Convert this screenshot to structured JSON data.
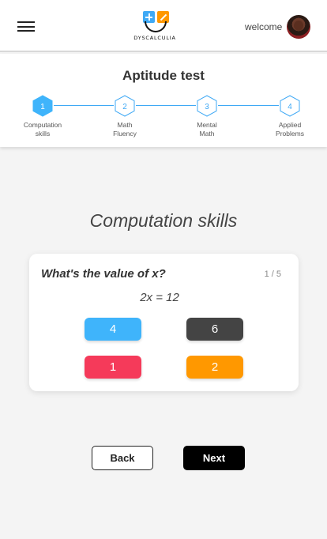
{
  "header": {
    "logo_text": "DYSCALCULIA",
    "welcome": "welcome"
  },
  "aptitude": {
    "title": "Aptitude test",
    "steps": [
      {
        "number": "1",
        "label_line1": "Computation",
        "label_line2": "skills",
        "active": true
      },
      {
        "number": "2",
        "label_line1": "Math",
        "label_line2": "Fluency",
        "active": false
      },
      {
        "number": "3",
        "label_line1": "Mental",
        "label_line2": "Math",
        "active": false
      },
      {
        "number": "4",
        "label_line1": "Applied",
        "label_line2": "Problems",
        "active": false
      }
    ]
  },
  "section_title": "Computation skills",
  "question_card": {
    "question": "What's the value of x?",
    "counter": "1 / 5",
    "equation": "2x = 12",
    "options": [
      {
        "label": "4",
        "color": "#3fb4fb"
      },
      {
        "label": "6",
        "color": "#444444"
      },
      {
        "label": "1",
        "color": "#f53a5a"
      },
      {
        "label": "2",
        "color": "#ff9800"
      }
    ]
  },
  "navigation": {
    "back_label": "Back",
    "next_label": "Next"
  },
  "colors": {
    "accent": "#3fa9f5"
  }
}
